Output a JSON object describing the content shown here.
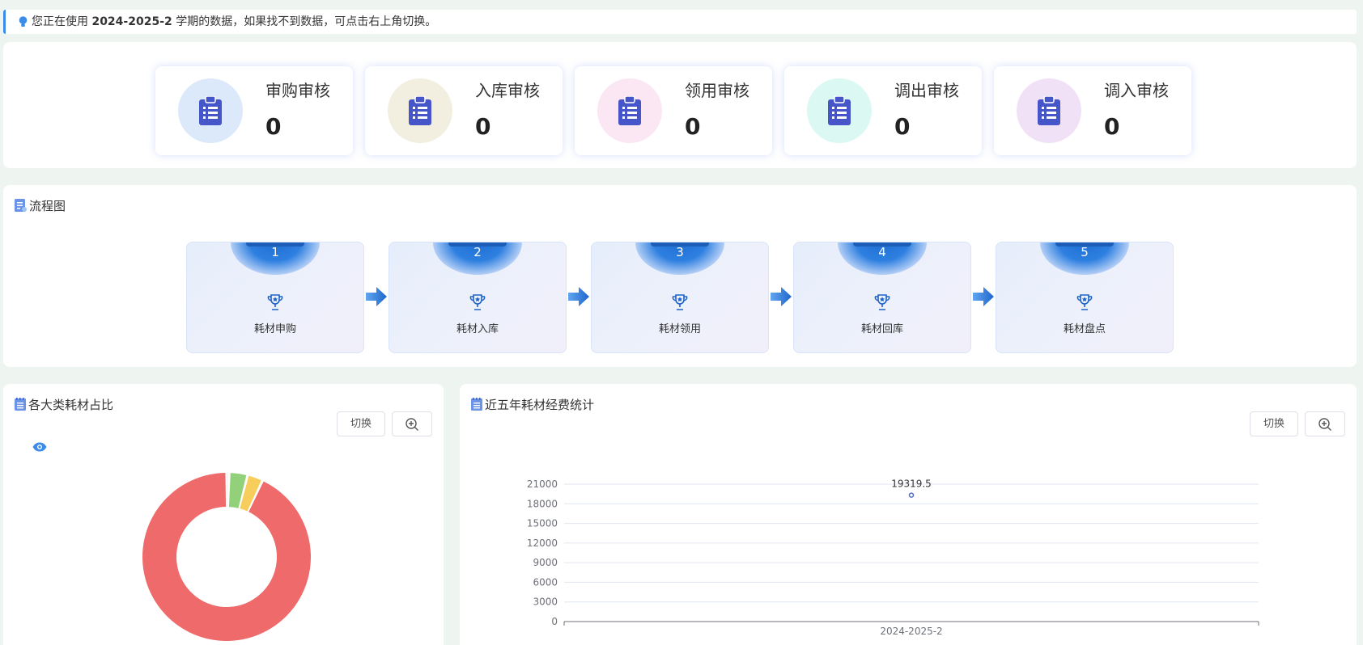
{
  "notice": {
    "prefix": "您正在使用 ",
    "semester": "2024-2025-2",
    "suffix": " 学期的数据，如果找不到数据，可点击右上角切换。"
  },
  "audits": [
    {
      "label": "审购审核",
      "count": "0",
      "color": "#dce9fb"
    },
    {
      "label": "入库审核",
      "count": "0",
      "color": "#f2efe0"
    },
    {
      "label": "领用审核",
      "count": "0",
      "color": "#fbe6f3"
    },
    {
      "label": "调出审核",
      "count": "0",
      "color": "#dbf8f2"
    },
    {
      "label": "调入审核",
      "count": "0",
      "color": "#f1e1f6"
    }
  ],
  "flow": {
    "title": "流程图",
    "steps": [
      {
        "num": "1",
        "name": "耗材申购"
      },
      {
        "num": "2",
        "name": "耗材入库"
      },
      {
        "num": "3",
        "name": "耗材领用"
      },
      {
        "num": "4",
        "name": "耗材回库"
      },
      {
        "num": "5",
        "name": "耗材盘点"
      }
    ]
  },
  "pie_panel": {
    "title": "各大类耗材占比",
    "switch_label": "切换"
  },
  "bar_panel": {
    "title": "近五年耗材经费统计",
    "switch_label": "切换"
  },
  "colors": {
    "accent": "#3b8ce8",
    "icon": "#4656c8",
    "step_tab": "#1d5fb8"
  },
  "chart_data": [
    {
      "type": "pie",
      "donut": true,
      "series": [
        {
          "value": 93.0,
          "color": "#ef6a6a"
        },
        {
          "value": 0.5,
          "color": "#f08a6a"
        },
        {
          "value": 3.5,
          "color": "#93d07a"
        },
        {
          "value": 3.0,
          "color": "#f7cd5b"
        }
      ]
    },
    {
      "type": "line",
      "categories": [
        "2024-2025-2"
      ],
      "values": [
        19319.5
      ],
      "y_ticks": [
        0,
        3000,
        6000,
        9000,
        12000,
        15000,
        18000,
        21000
      ],
      "ylim": [
        0,
        21000
      ],
      "grid": true
    }
  ]
}
